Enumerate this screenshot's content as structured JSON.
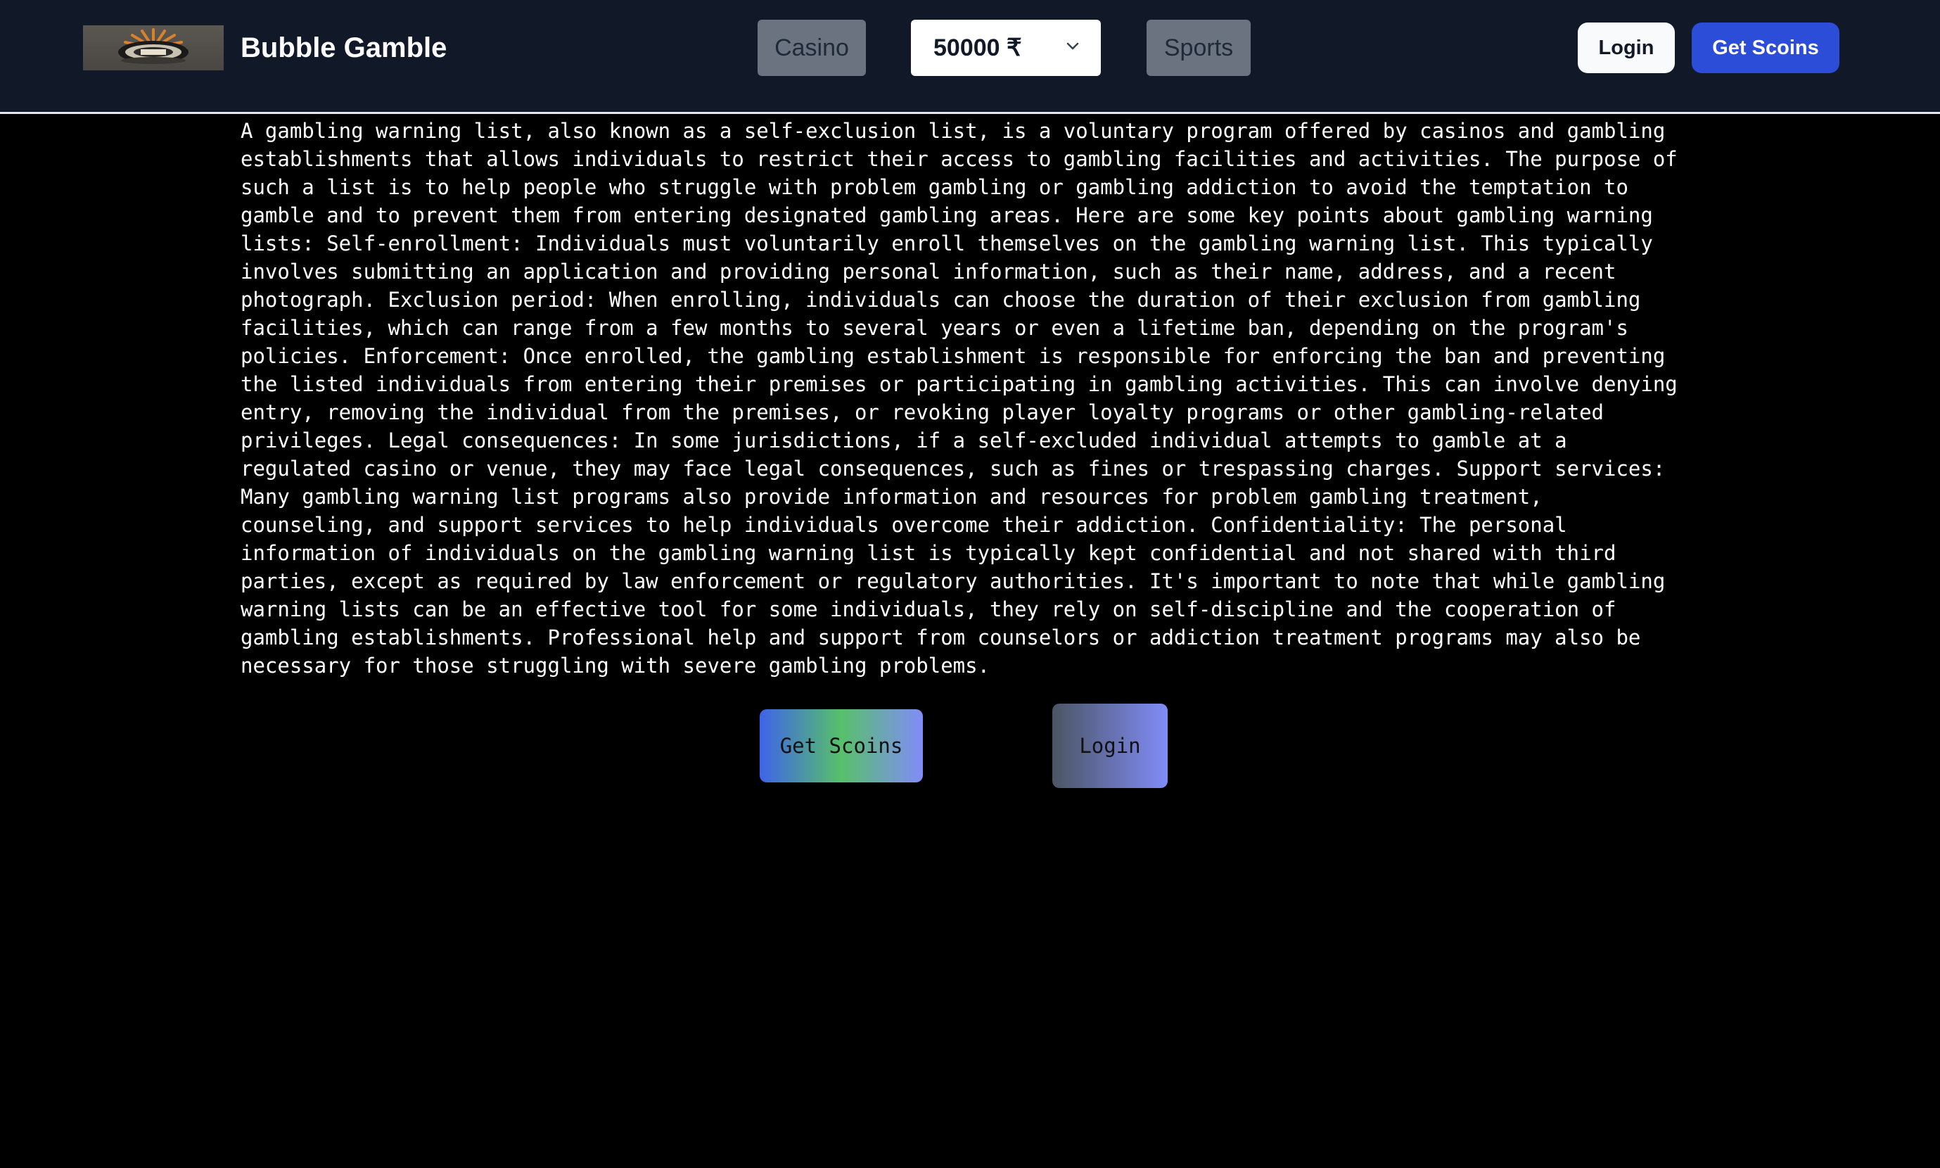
{
  "header": {
    "brand": "Bubble Gamble",
    "logo_icon": "roulette-logo-icon",
    "nav": {
      "casino_label": "Casino",
      "sports_label": "Sports"
    },
    "balance": {
      "value": "50000 ₹",
      "icon": "chevron-down-icon"
    },
    "login_label": "Login",
    "get_scoins_label": "Get Scoins"
  },
  "main": {
    "article_text": "A gambling warning list, also known as a self-exclusion list, is a voluntary program offered by casinos and gambling establishments that allows individuals to restrict their access to gambling facilities and activities. The purpose of such a list is to help people who struggle with problem gambling or gambling addiction to avoid the temptation to gamble and to prevent them from entering designated gambling areas. Here are some key points about gambling warning lists: Self-enrollment: Individuals must voluntarily enroll themselves on the gambling warning list. This typically involves submitting an application and providing personal information, such as their name, address, and a recent photograph. Exclusion period: When enrolling, individuals can choose the duration of their exclusion from gambling facilities, which can range from a few months to several years or even a lifetime ban, depending on the program's policies. Enforcement: Once enrolled, the gambling establishment is responsible for enforcing the ban and preventing the listed individuals from entering their premises or participating in gambling activities. This can involve denying entry, removing the individual from the premises, or revoking player loyalty programs or other gambling-related privileges. Legal consequences: In some jurisdictions, if a self-excluded individual attempts to gamble at a regulated casino or venue, they may face legal consequences, such as fines or trespassing charges. Support services: Many gambling warning list programs also provide information and resources for problem gambling treatment, counseling, and support services to help individuals overcome their addiction. Confidentiality: The personal information of individuals on the gambling warning list is typically kept confidential and not shared with third parties, except as required by law enforcement or regulatory authorities. It's important to note that while gambling warning lists can be an effective tool for some individuals, they rely on self-discipline and the cooperation of gambling establishments. Professional help and support from counselors or addiction treatment programs may also be necessary for those struggling with severe gambling problems.",
    "get_scoins_label": "Get Scoins",
    "login_label": "Login"
  },
  "colors": {
    "navbar_bg": "#111827",
    "page_bg": "#000000",
    "primary_blue": "#2b4dd8",
    "nav_pill": "#6b7280"
  }
}
